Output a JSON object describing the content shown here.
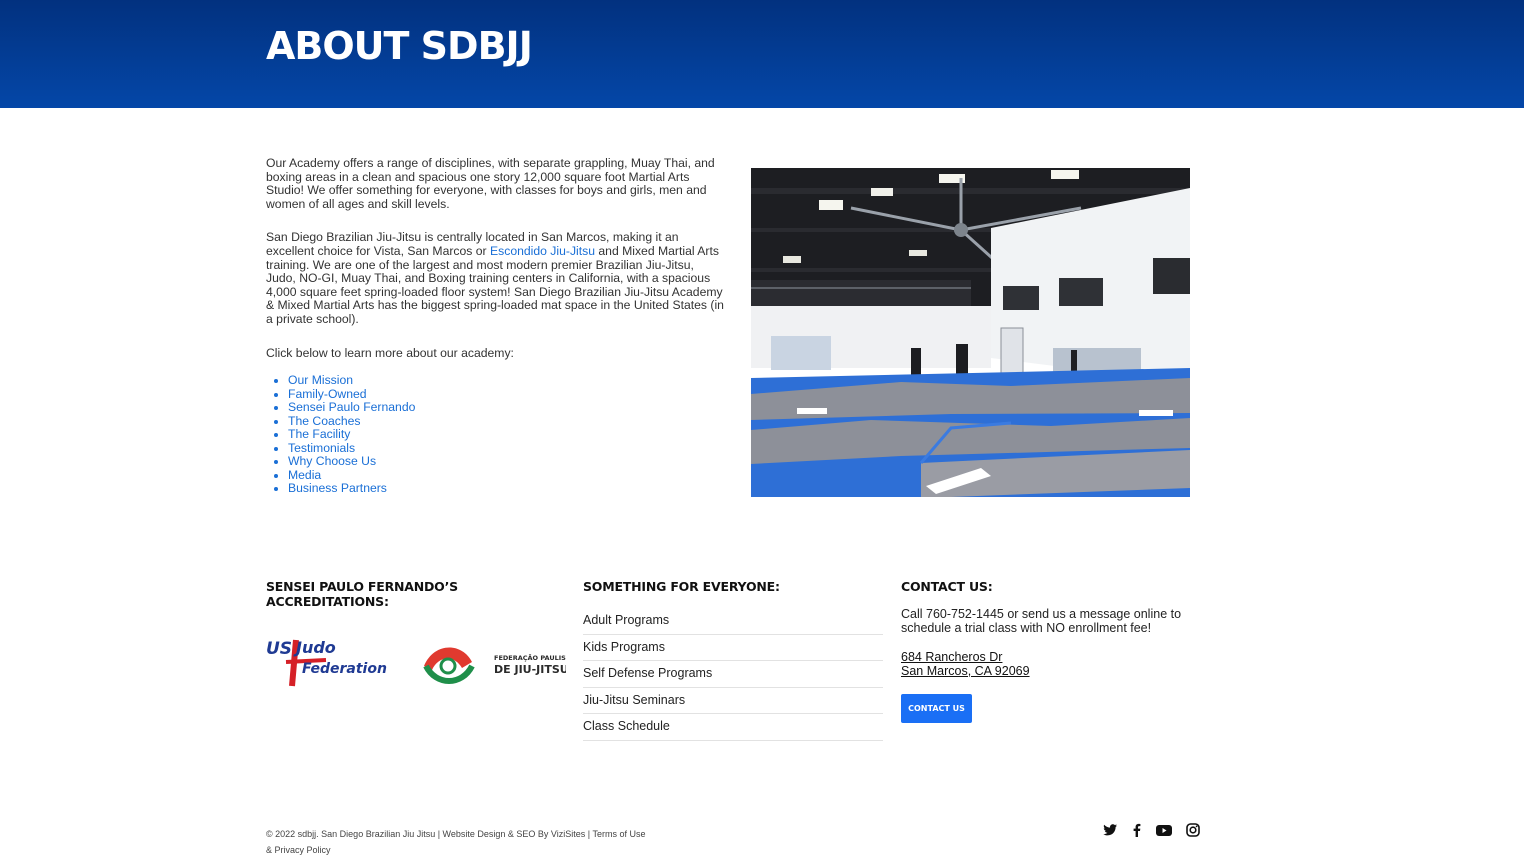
{
  "hero": {
    "title": "ABOUT SDBJJ"
  },
  "intro": {
    "p1": "Our Academy offers a range of disciplines, with separate grappling, Muay Thai, and boxing areas in a clean and spacious one story 12,000 square foot Martial Arts Studio! We offer something for everyone, with classes for boys and girls, men and women of all ages and skill levels.",
    "p2_before": "San Diego Brazilian Jiu-Jitsu is centrally located in San Marcos, making it an excellent choice for Vista, San Marcos or ",
    "p2_link": "Escondido Jiu-Jitsu",
    "p2_after": " and Mixed Martial Arts training. We are one of the largest and most modern premier Brazilian Jiu-Jitsu, Judo, NO-GI, Muay Thai, and Boxing training centers in California, with a spacious 4,000 square feet spring-loaded floor system! San Diego Brazilian Jiu-Jitsu Academy & Mixed Martial Arts has the biggest spring-loaded mat space in the United States (in a private school).",
    "p3": "Click below to learn more about our academy:",
    "links": [
      "Our Mission",
      "Family-Owned",
      "Sensei Paulo Fernando",
      "The Coaches",
      "The Facility",
      "Testimonials",
      "Why Choose Us",
      "Media",
      "Business Partners"
    ]
  },
  "footer_cols": {
    "accreditations_title": "SENSEI PAULO FERNANDO’S ACCREDITATIONS:",
    "logo1": {
      "line1": "US",
      "line2": "Judo",
      "line3": "Federation"
    },
    "logo2": {
      "line1": "FEDERAÇÃO PAULISTA",
      "line2": "DE JIU-JITSU"
    },
    "programs_title": "SOMETHING FOR EVERYONE:",
    "programs": [
      "Adult Programs",
      "Kids Programs",
      "Self Defense Programs",
      "Jiu-Jitsu Seminars",
      "Class Schedule"
    ],
    "contact_title": "CONTACT US:",
    "contact_text": "Call 760-752-1445 or send us a message online to schedule a trial class with NO enrollment fee!",
    "address_line1": "684 Rancheros Dr",
    "address_line2": "San Marcos, CA 92069",
    "contact_button": "CONTACT US"
  },
  "footer": {
    "copyright": "© 2022 sdbjj. San Diego Brazilian Jiu Jitsu | Website Design & SEO By ViziSites | Terms of Use & Privacy Policy"
  },
  "social_icons": [
    "twitter-icon",
    "facebook-icon",
    "youtube-icon",
    "instagram-icon"
  ],
  "colors": {
    "hero_top": "#02317f",
    "hero_bottom": "#0447a8",
    "link": "#1a6fd6",
    "button": "#1a6ff5"
  }
}
